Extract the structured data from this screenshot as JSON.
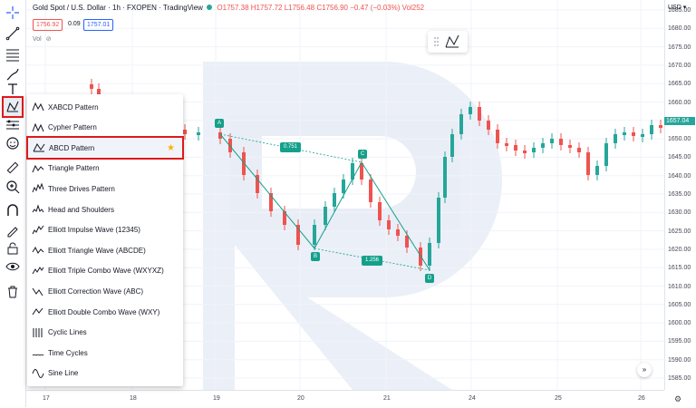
{
  "legend": {
    "symbol": "Gold Spot / U.S. Dollar · 1h · FXOPEN · TradingView",
    "o": "O1757.38",
    "h": "H1757.72",
    "l": "L1756.48",
    "c": "C1756.90",
    "chg": "−0.47 (−0.03%)",
    "vol": "Vol252",
    "bid": "1756.92",
    "spread": "0.09",
    "ask": "1757.01",
    "vol_label": "Vol"
  },
  "currency": "USD ▾",
  "last_price": "1657.04",
  "price_axis": [
    "1685.00",
    "1680.00",
    "1675.00",
    "1670.00",
    "1665.00",
    "1660.00",
    "1655.00",
    "1650.00",
    "1645.00",
    "1640.00",
    "1635.00",
    "1630.00",
    "1625.00",
    "1620.00",
    "1615.00",
    "1610.00",
    "1605.00",
    "1600.00",
    "1595.00",
    "1590.00",
    "1585.00"
  ],
  "time_axis": [
    "17",
    "18",
    "19",
    "20",
    "21",
    "24",
    "25",
    "26"
  ],
  "pattern": {
    "points": [
      "A",
      "B",
      "C",
      "D"
    ],
    "ratios": [
      "0.751",
      "1.256"
    ]
  },
  "menu": {
    "items": [
      {
        "label": "XABCD Pattern",
        "icon": "xabcd-icon"
      },
      {
        "label": "Cypher Pattern",
        "icon": "cypher-icon"
      },
      {
        "label": "ABCD Pattern",
        "icon": "abcd-icon"
      },
      {
        "label": "Triangle Pattern",
        "icon": "triangle-pattern-icon"
      },
      {
        "label": "Three Drives Pattern",
        "icon": "three-drives-icon"
      },
      {
        "label": "Head and Shoulders",
        "icon": "head-shoulders-icon"
      },
      {
        "label": "Elliott Impulse Wave (12345)",
        "icon": "elliott-impulse-icon"
      },
      {
        "label": "Elliott Triangle Wave (ABCDE)",
        "icon": "elliott-triangle-icon"
      },
      {
        "label": "Elliott Triple Combo Wave (WXYXZ)",
        "icon": "elliott-triple-icon"
      },
      {
        "label": "Elliott Correction Wave (ABC)",
        "icon": "elliott-correction-icon"
      },
      {
        "label": "Elliott Double Combo Wave (WXY)",
        "icon": "elliott-double-icon"
      },
      {
        "label": "Cyclic Lines",
        "icon": "cyclic-lines-icon"
      },
      {
        "label": "Time Cycles",
        "icon": "time-cycles-icon"
      },
      {
        "label": "Sine Line",
        "icon": "sine-line-icon"
      }
    ],
    "star": "★"
  },
  "colors": {
    "up": "#26a69a",
    "down": "#ef5350",
    "pattern": "#14a08b",
    "highlight": "#e0191a"
  }
}
